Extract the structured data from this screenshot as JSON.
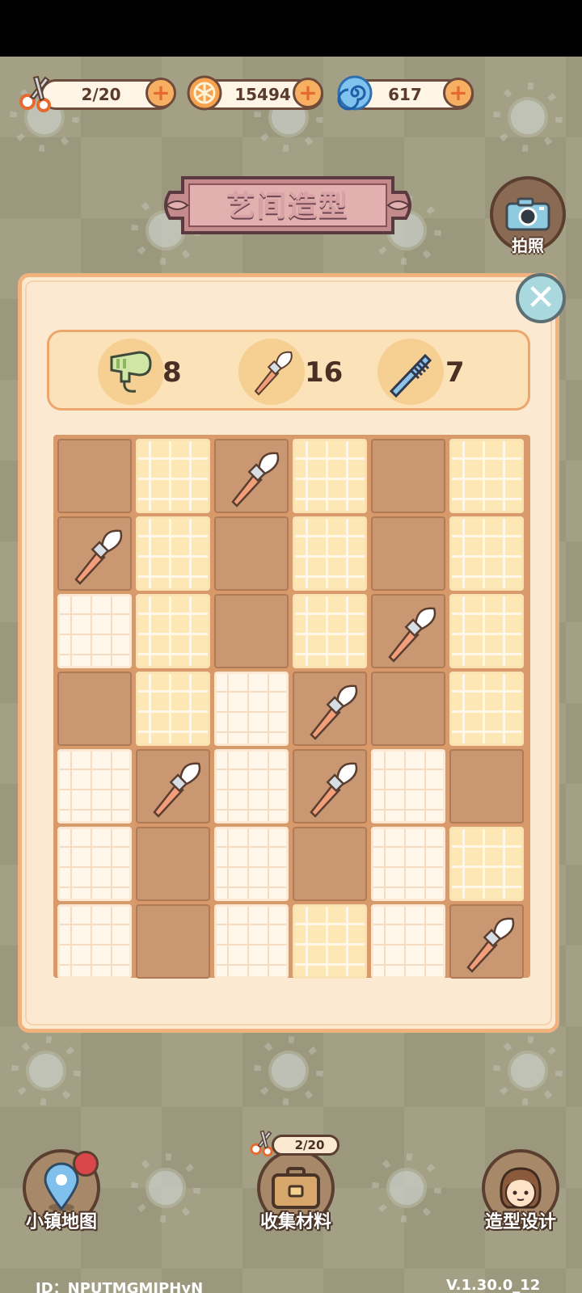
{
  "resources": {
    "scissors": {
      "icon": "scissors-icon",
      "value": "2/20"
    },
    "coins": {
      "icon": "coin-icon",
      "value": "15494"
    },
    "swirl": {
      "icon": "swirl-icon",
      "value": "617"
    },
    "add_symbol": "+"
  },
  "title": "艺间造型",
  "camera": {
    "icon": "camera-icon",
    "label": "拍照"
  },
  "close": {
    "icon": "close-icon",
    "symbol": "✕"
  },
  "tools": [
    {
      "icon": "hair-dryer-icon",
      "count": "8"
    },
    {
      "icon": "makeup-brush-icon",
      "count": "16"
    },
    {
      "icon": "comb-icon",
      "count": "7"
    }
  ],
  "grid": {
    "rows": 7,
    "cols": 6,
    "cells": [
      [
        "covered",
        "yellow",
        "brush",
        "yellow",
        "covered",
        "yellow"
      ],
      [
        "brush",
        "yellow",
        "covered",
        "yellow",
        "covered",
        "yellow"
      ],
      [
        "cream",
        "yellow",
        "covered",
        "yellow",
        "brush",
        "yellow"
      ],
      [
        "covered",
        "yellow",
        "cream",
        "brush",
        "covered",
        "yellow"
      ],
      [
        "cream",
        "brush",
        "cream",
        "brush",
        "cream",
        "covered"
      ],
      [
        "cream",
        "covered",
        "cream",
        "covered",
        "cream",
        "yellow"
      ],
      [
        "cream",
        "covered",
        "cream",
        "yellow",
        "cream",
        "brush"
      ]
    ]
  },
  "nav": {
    "map": {
      "icon": "map-pin-icon",
      "label": "小镇地图"
    },
    "collect": {
      "icon": "suitcase-icon",
      "label": "收集材料",
      "badge": "2/20"
    },
    "design": {
      "icon": "character-avatar-icon",
      "label": "造型设计"
    }
  },
  "footer": {
    "id": "ID：NPUTMGMJPHyN",
    "version": "V.1.30.0_12"
  },
  "colors": {
    "panel_bg": "#fbe9d2",
    "panel_border": "#f1b27e",
    "covered_cell": "#c99772",
    "accent_orange": "#f7b061"
  }
}
